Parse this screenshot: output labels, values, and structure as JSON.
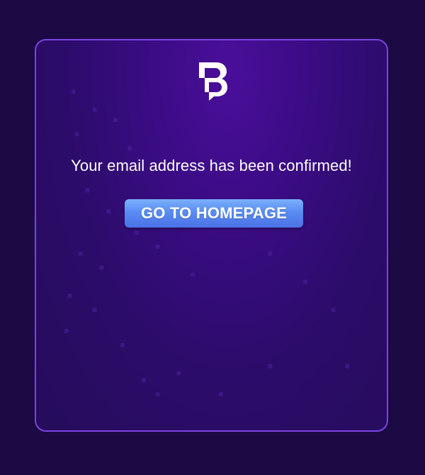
{
  "logo": {
    "icon": "brand-logo-icon",
    "color": "#ffffff"
  },
  "message": {
    "text": "Your email address has been confirmed!"
  },
  "button": {
    "label": "GO TO HOMEPAGE",
    "color": "#5a8cf3"
  },
  "colors": {
    "background": "#1c0a45",
    "card_border": "#7b43e0",
    "card_fill": "#3a0c84"
  }
}
